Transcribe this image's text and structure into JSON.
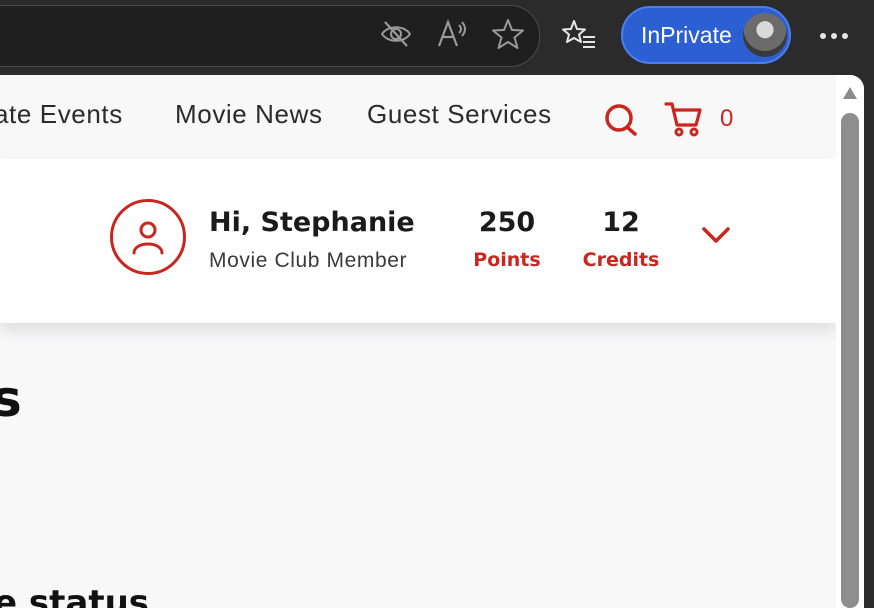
{
  "browser": {
    "inprivate_label": "InPrivate"
  },
  "nav": {
    "links": [
      {
        "label": "ate Events"
      },
      {
        "label": "Movie News"
      },
      {
        "label": "Guest Services"
      }
    ],
    "cart_count": "0"
  },
  "member": {
    "greeting": "Hi, Stephanie",
    "tier": "Movie Club Member",
    "points_value": "250",
    "points_label": "Points",
    "credits_value": "12",
    "credits_label": "Credits"
  },
  "content": {
    "heading_fragment": "s",
    "subheading_fragment": "e status"
  },
  "colors": {
    "accent_red": "#c8261f",
    "inprivate_blue": "#2c5fd2",
    "chrome_dark": "#2b2b2b"
  },
  "icons": [
    "hide-icon",
    "read-aloud-icon",
    "favorite-star-icon",
    "favorites-list-icon",
    "more-icon",
    "search-icon",
    "cart-icon",
    "user-icon",
    "chevron-down-icon"
  ]
}
